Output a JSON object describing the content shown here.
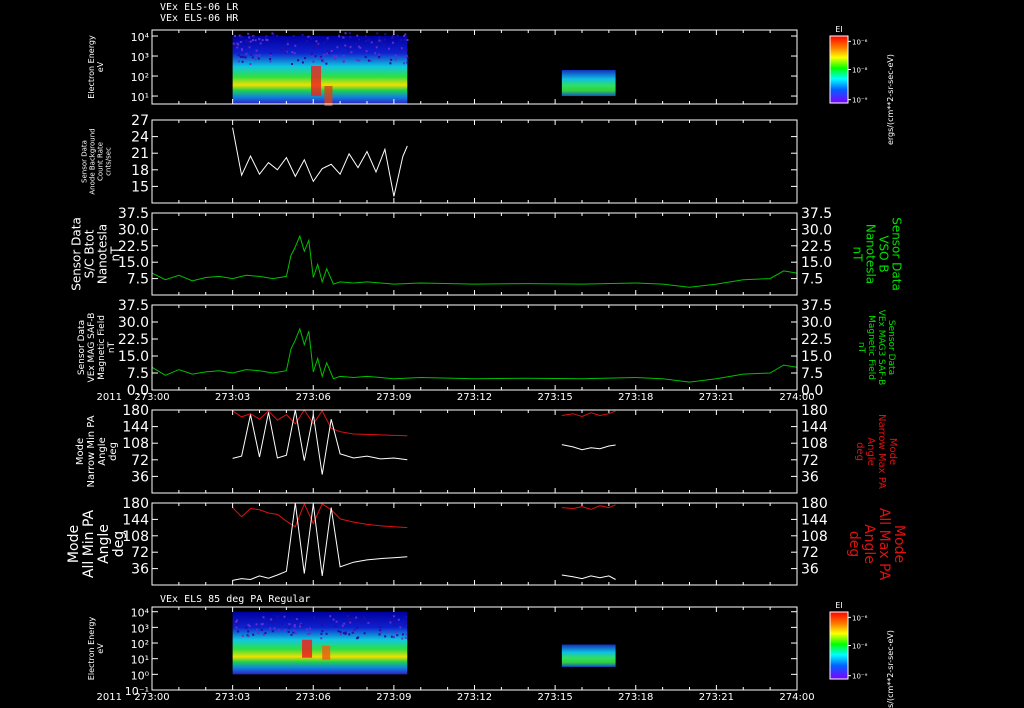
{
  "header_lines": [
    "VEx ELS-06 LR",
    "VEx ELS-06 HR"
  ],
  "bottom_header": "VEx ELS 85 deg PA Regular",
  "colors": {
    "background": "#000000",
    "frame": "#ffffff",
    "magnetic_field": "#00c000",
    "right_label_green": "#00e000",
    "max_pa": "#e01010",
    "min_pa": "#ffffff"
  },
  "time_axis": {
    "year": "2011",
    "ticks": [
      "273:00",
      "273:03",
      "273:06",
      "273:09",
      "273:12",
      "273:15",
      "273:18",
      "273:21",
      "274:00"
    ],
    "xlim": [
      "273:00",
      "274:00"
    ]
  },
  "colorbar": {
    "title": "EI",
    "units": "ergs/(cm**2-sr-sec-eV)",
    "ticks": [
      "10⁻⁶",
      "10⁻⁸",
      "10⁻⁹"
    ]
  },
  "chart_data": [
    {
      "id": "els_energy_top",
      "type": "heatmap",
      "ylabel": [
        "Electron Energy",
        "eV"
      ],
      "yscale": "log",
      "ylim": [
        4,
        20000
      ],
      "yticks": [
        "10⁴",
        "10³",
        "10²",
        "10¹"
      ],
      "segments": [
        {
          "x": [
            "273:03",
            "273:09:30"
          ],
          "energy_range": [
            4,
            10000
          ]
        },
        {
          "x": [
            "273:15:15",
            "273:17:15"
          ],
          "energy_range": [
            10,
            200
          ]
        }
      ]
    },
    {
      "id": "anode_background",
      "type": "line",
      "ylabel": [
        "Sensor Data",
        "Anode Background",
        "Count Rate",
        "cnts/sec"
      ],
      "ylim": [
        12,
        27
      ],
      "yticks": [
        "27",
        "24",
        "21",
        "18",
        "15"
      ],
      "series": [
        {
          "color": "#ffffff",
          "x": [
            "273:03:00",
            "273:03:20",
            "273:03:40",
            "273:04:00",
            "273:04:20",
            "273:04:40",
            "273:05:00",
            "273:05:20",
            "273:05:40",
            "273:06:00",
            "273:06:20",
            "273:06:40",
            "273:07:00",
            "273:07:20",
            "273:07:40",
            "273:08:00",
            "273:08:20",
            "273:08:40",
            "273:09:00",
            "273:09:20",
            "273:09:30"
          ],
          "values": [
            25.6,
            17.0,
            20.5,
            17.2,
            19.3,
            18.0,
            20.2,
            16.8,
            19.8,
            15.9,
            18.2,
            19.0,
            17.2,
            20.9,
            18.4,
            21.3,
            17.6,
            21.7,
            13.2,
            20.4,
            22.3
          ]
        }
      ]
    },
    {
      "id": "sc_btot",
      "type": "line",
      "ylabel": [
        "Sensor Data",
        "S/C Btot",
        "Nanotesla",
        "nT"
      ],
      "right_label": [
        "Sensor Data",
        "VSO B",
        "Nanotesla",
        "nT"
      ],
      "ylim": [
        0,
        37.5
      ],
      "yticks": [
        "37.5",
        "30.0",
        "22.5",
        "15.0",
        "7.5"
      ],
      "series": [
        {
          "color": "#00c000",
          "x": [
            "273:00",
            "273:00:30",
            "273:01",
            "273:01:30",
            "273:02",
            "273:02:30",
            "273:03",
            "273:03:30",
            "273:04",
            "273:04:30",
            "273:05",
            "273:05:10",
            "273:05:20",
            "273:05:30",
            "273:05:40",
            "273:05:50",
            "273:06",
            "273:06:10",
            "273:06:20",
            "273:06:30",
            "273:06:45",
            "273:07",
            "273:07:30",
            "273:08",
            "273:09",
            "273:10",
            "273:12",
            "273:14",
            "273:16",
            "273:18",
            "273:19",
            "273:20",
            "273:21",
            "273:22",
            "273:23",
            "273:23:30",
            "274:00"
          ],
          "values": [
            10,
            7,
            9,
            6.5,
            8,
            8.5,
            7.5,
            9,
            8.5,
            7.5,
            8.5,
            18,
            22,
            27,
            20,
            25,
            8,
            14,
            6,
            12,
            5,
            6,
            5.5,
            6,
            5,
            5.5,
            5,
            5.2,
            5,
            5.5,
            5,
            3.5,
            5,
            7,
            7.5,
            11,
            10
          ]
        }
      ]
    },
    {
      "id": "mag_saf_b",
      "type": "line",
      "ylabel": [
        "Sensor Data",
        "VEx MAG SAF-B",
        "Magnetic Field",
        "nT"
      ],
      "right_label": [
        "Sensor Data",
        "VEx MAG3 SAF-B",
        "Magnetic Field",
        "nT"
      ],
      "ylim": [
        0,
        37.5
      ],
      "yticks": [
        "37.5",
        "30.0",
        "22.5",
        "15.0",
        "7.5",
        "0.0"
      ],
      "series": [
        {
          "color": "#00c000",
          "x": [
            "273:00",
            "273:00:30",
            "273:01",
            "273:01:30",
            "273:02",
            "273:02:30",
            "273:03",
            "273:03:30",
            "273:04",
            "273:04:30",
            "273:05",
            "273:05:10",
            "273:05:20",
            "273:05:30",
            "273:05:40",
            "273:05:50",
            "273:06",
            "273:06:10",
            "273:06:20",
            "273:06:30",
            "273:06:45",
            "273:07",
            "273:07:30",
            "273:08",
            "273:09",
            "273:10",
            "273:12",
            "273:14",
            "273:16",
            "273:18",
            "273:19",
            "273:20",
            "273:21",
            "273:22",
            "273:23",
            "273:23:30",
            "274:00"
          ],
          "values": [
            10,
            6.5,
            9,
            7,
            8,
            8.5,
            7.5,
            9,
            8.5,
            7.5,
            8.5,
            18,
            22,
            27,
            20,
            26,
            8,
            14,
            6,
            12,
            5,
            6,
            5.5,
            6,
            5,
            5.5,
            5,
            5.2,
            5,
            5.5,
            5,
            3.5,
            5,
            7,
            7.5,
            11,
            10
          ]
        }
      ]
    },
    {
      "id": "narrow_pa",
      "type": "line",
      "ylabel": [
        "Mode",
        "Narrow Min PA",
        "Angle",
        "deg"
      ],
      "right_label": [
        "Mode",
        "Narrow Max PA",
        "Angle",
        "deg"
      ],
      "ylim": [
        0,
        180
      ],
      "yticks": [
        "180",
        "144",
        "108",
        "72",
        "36"
      ],
      "series": [
        {
          "name": "Max PA",
          "color": "#e01010",
          "x": [
            "273:03",
            "273:03:20",
            "273:03:40",
            "273:04",
            "273:04:20",
            "273:04:40",
            "273:05",
            "273:05:20",
            "273:05:40",
            "273:06",
            "273:06:20",
            "273:06:40",
            "273:07",
            "273:07:30",
            "273:08",
            "273:08:30",
            "273:09",
            "273:09:30"
          ],
          "values": [
            178,
            165,
            172,
            160,
            178,
            158,
            170,
            150,
            180,
            150,
            178,
            140,
            133,
            128,
            127,
            126,
            125,
            124
          ]
        },
        {
          "name": "Min PA",
          "color": "#ffffff",
          "x": [
            "273:03",
            "273:03:20",
            "273:03:40",
            "273:04",
            "273:04:20",
            "273:04:40",
            "273:05",
            "273:05:20",
            "273:05:40",
            "273:06",
            "273:06:20",
            "273:06:40",
            "273:07",
            "273:07:30",
            "273:08",
            "273:08:30",
            "273:09",
            "273:09:30"
          ],
          "values": [
            75,
            80,
            170,
            78,
            175,
            76,
            82,
            180,
            70,
            170,
            40,
            160,
            85,
            76,
            80,
            74,
            76,
            72
          ]
        },
        {
          "name": "Max PA",
          "color": "#e01010",
          "x": [
            "273:15:15",
            "273:15:40",
            "273:16",
            "273:16:20",
            "273:16:40",
            "273:17",
            "273:17:15"
          ],
          "values": [
            168,
            172,
            166,
            174,
            168,
            172,
            178
          ]
        },
        {
          "name": "Min PA",
          "color": "#ffffff",
          "x": [
            "273:15:15",
            "273:15:40",
            "273:16",
            "273:16:20",
            "273:16:40",
            "273:17",
            "273:17:15"
          ],
          "values": [
            105,
            100,
            94,
            98,
            96,
            102,
            104
          ]
        }
      ]
    },
    {
      "id": "all_pa",
      "type": "line",
      "ylabel": [
        "Mode",
        "All Min PA",
        "Angle",
        "deg"
      ],
      "right_label": [
        "Mode",
        "All Max PA",
        "Angle",
        "deg"
      ],
      "ylim": [
        0,
        180
      ],
      "yticks": [
        "180",
        "144",
        "108",
        "72",
        "36"
      ],
      "series": [
        {
          "name": "Max PA",
          "color": "#e01010",
          "x": [
            "273:03",
            "273:03:20",
            "273:03:40",
            "273:04",
            "273:04:20",
            "273:04:40",
            "273:05",
            "273:05:20",
            "273:05:40",
            "273:06",
            "273:06:20",
            "273:06:40",
            "273:07",
            "273:07:30",
            "273:08",
            "273:08:30",
            "273:09",
            "273:09:30"
          ],
          "values": [
            170,
            150,
            168,
            165,
            158,
            155,
            140,
            128,
            178,
            135,
            178,
            165,
            145,
            138,
            133,
            130,
            128,
            126
          ]
        },
        {
          "name": "Min PA",
          "color": "#ffffff",
          "x": [
            "273:03",
            "273:03:20",
            "273:03:40",
            "273:04",
            "273:04:20",
            "273:04:40",
            "273:05",
            "273:05:20",
            "273:05:40",
            "273:06",
            "273:06:20",
            "273:06:40",
            "273:07",
            "273:07:30",
            "273:08",
            "273:08:30",
            "273:09",
            "273:09:30"
          ],
          "values": [
            10,
            14,
            12,
            20,
            15,
            22,
            30,
            180,
            25,
            178,
            20,
            170,
            40,
            50,
            55,
            58,
            60,
            62
          ]
        },
        {
          "name": "Max PA",
          "color": "#e01010",
          "x": [
            "273:15:15",
            "273:15:40",
            "273:16",
            "273:16:20",
            "273:16:40",
            "273:17",
            "273:17:15"
          ],
          "values": [
            170,
            168,
            172,
            166,
            174,
            170,
            176
          ]
        },
        {
          "name": "Min PA",
          "color": "#ffffff",
          "x": [
            "273:15:15",
            "273:15:40",
            "273:16",
            "273:16:20",
            "273:16:40",
            "273:17",
            "273:17:15"
          ],
          "values": [
            22,
            18,
            14,
            20,
            16,
            20,
            12
          ]
        }
      ]
    },
    {
      "id": "els_85deg_pa",
      "type": "heatmap",
      "ylabel": [
        "Electron Energy",
        "eV"
      ],
      "yscale": "log",
      "ylim": [
        0.1,
        20000
      ],
      "yticks": [
        "10⁴",
        "10³",
        "10²",
        "10¹",
        "10⁰",
        "10⁻¹"
      ],
      "segments": [
        {
          "x": [
            "273:03",
            "273:09:30"
          ],
          "energy_range": [
            1,
            10000
          ]
        },
        {
          "x": [
            "273:15:15",
            "273:17:15"
          ],
          "energy_range": [
            3,
            80
          ]
        }
      ]
    }
  ]
}
